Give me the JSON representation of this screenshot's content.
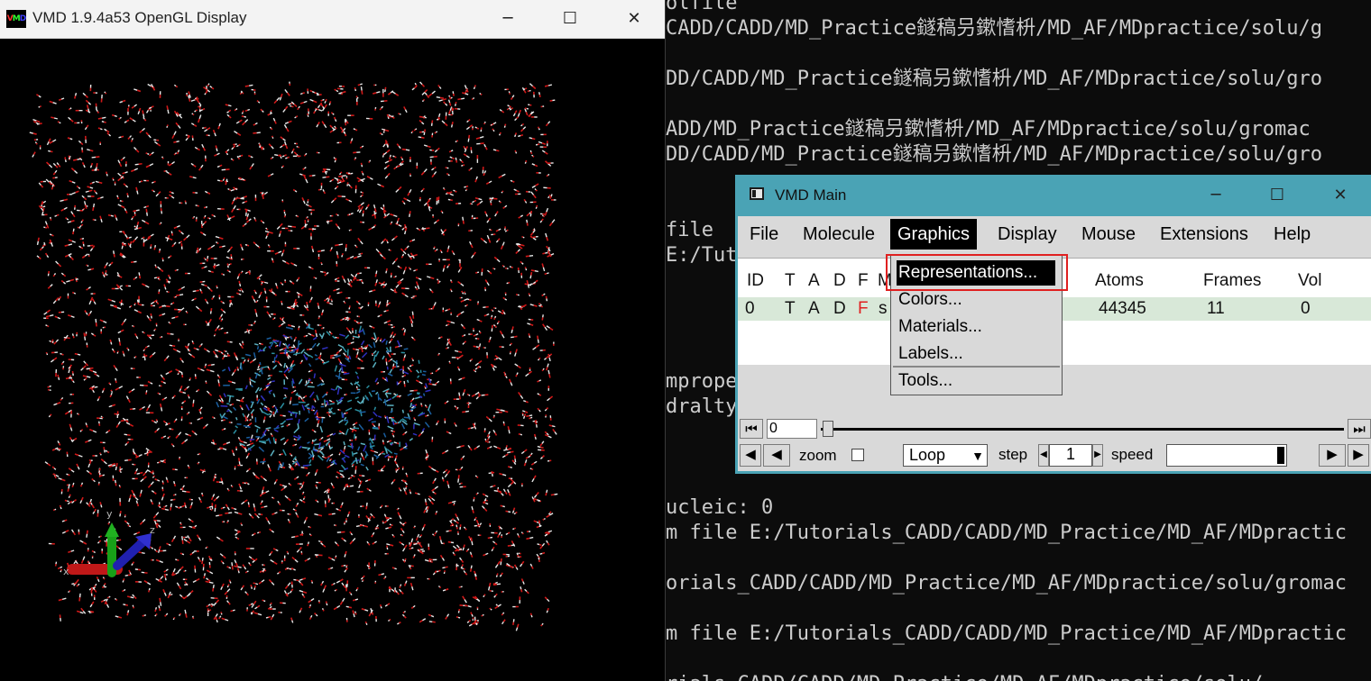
{
  "terminal": {
    "lines": [
      "olfile",
      "CADD/CADD/MD_Practice鐩稿叧鏉愭枡/MD_AF/MDpractice/solu/g",
      "",
      "DD/CADD/MD_Practice鐩稿叧鏉愭枡/MD_AF/MDpractice/solu/gro",
      "",
      "ADD/MD_Practice鐩稿叧鏉愭枡/MD_AF/MDpractice/solu/gromac",
      "DD/CADD/MD_Practice鐩稿叧鏉愭枡/MD_AF/MDpractice/solu/gro",
      "",
      "",
      "file",
      "E:/Tut",
      "",
      "",
      "",
      "",
      "mprope",
      "dralty",
      "",
      "",
      "",
      "ucleic: 0",
      "m file E:/Tutorials_CADD/CADD/MD_Practice/MD_AF/MDpractic",
      "",
      "orials_CADD/CADD/MD_Practice/MD_AF/MDpractice/solu/gromac",
      "",
      "m file E:/Tutorials_CADD/CADD/MD_Practice/MD_AF/MDpractic",
      "",
      "rials_CADD/CADD/MD_Practice/MD_AF/MDpractice/solu/"
    ]
  },
  "gl_window": {
    "title": "VMD 1.9.4a53 OpenGL Display",
    "minimize": "─",
    "maximize": "☐",
    "close": "✕",
    "axes": {
      "x": "x",
      "y": "y",
      "z": "z"
    }
  },
  "vmd_main": {
    "title": "VMD Main",
    "minimize": "─",
    "maximize": "☐",
    "close": "✕",
    "menu": [
      "File",
      "Molecule",
      "Graphics",
      "Display",
      "Mouse",
      "Extensions",
      "Help"
    ],
    "active_menu": "Graphics",
    "columns": {
      "id": "ID",
      "t": "T",
      "a": "A",
      "d": "D",
      "f": "F",
      "m": "M",
      "atoms": "Atoms",
      "frames": "Frames",
      "vol": "Vol"
    },
    "molecule": {
      "id": "0",
      "t": "T",
      "a": "A",
      "d": "D",
      "f": "F",
      "m": "s",
      "atoms": "44345",
      "frames": "11",
      "vol": "0"
    },
    "animation": {
      "frame": "0",
      "zoom_label": "zoom",
      "loop_value": "Loop",
      "step_label": "step",
      "step_value": "1",
      "speed_label": "speed"
    }
  },
  "graphics_menu": {
    "items": [
      "Representations...",
      "Colors...",
      "Materials...",
      "Labels...",
      "Tools..."
    ],
    "highlighted": "Representations..."
  },
  "colors": {
    "vmd_frame": "#4aa3b5",
    "oxygen": "#d01818",
    "hydrogen": "#e8e8e8",
    "highlight": "#e02020"
  }
}
